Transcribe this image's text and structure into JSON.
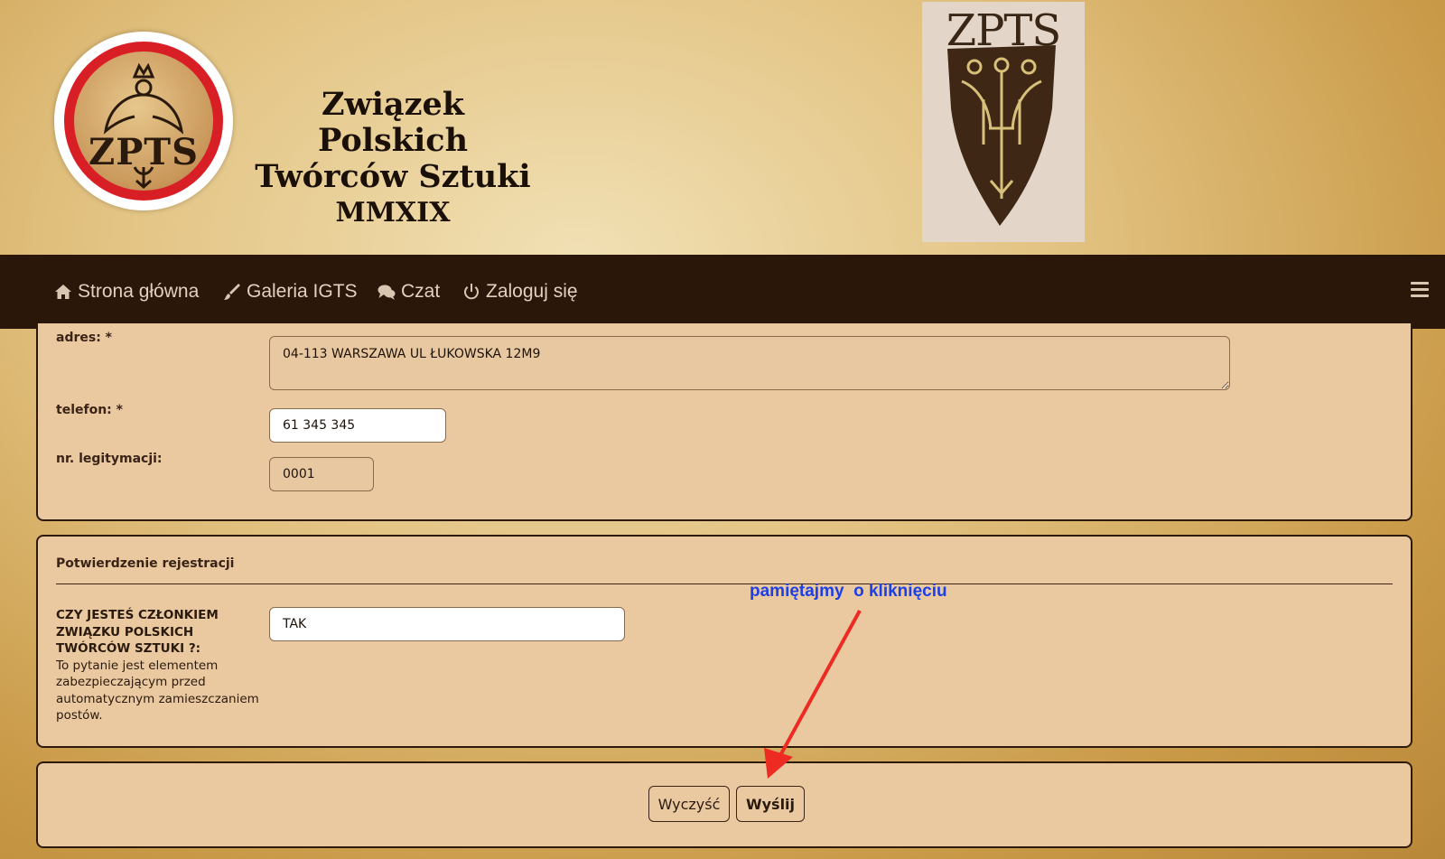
{
  "header": {
    "logo_text": "ZPTS",
    "title_line1": "Związek Polskich",
    "title_line2": "Twórców Sztuki",
    "year": "MMXIX",
    "shield_text": "ZPTS"
  },
  "nav": {
    "items": [
      {
        "label": "Strona główna",
        "icon": "home-icon"
      },
      {
        "label": "Galeria IGTS",
        "icon": "brush-icon"
      },
      {
        "label": "Czat",
        "icon": "chat-icon"
      },
      {
        "label": "Zaloguj się",
        "icon": "power-icon"
      }
    ],
    "menu_icon": "hamburger-icon"
  },
  "profile": {
    "address_label": "adres: *",
    "address_value": "04-113 WARSZAWA UL ŁUKOWSKA 12M9",
    "phone_label": "telefon: *",
    "phone_value": "61 345 345",
    "card_label": "nr. legitymacji:",
    "card_value": "0001"
  },
  "confirmation": {
    "section_title": "Potwierdzenie rejestracji",
    "question": "CZY JESTEŚ CZŁONKIEM ZWIĄZKU POLSKICH TWÓRCÓW SZTUKI ?:",
    "explain": "To pytanie jest elementem zabezpieczającym przed automatycznym zamieszczaniem postów.",
    "answer_value": "TAK"
  },
  "annotation": {
    "text": "pamiętajmy  o kliknięciu",
    "color": "#1c3fe6",
    "arrow_color": "#ee2b22"
  },
  "actions": {
    "reset_label": "Wyczyść",
    "submit_label": "Wyślij"
  }
}
